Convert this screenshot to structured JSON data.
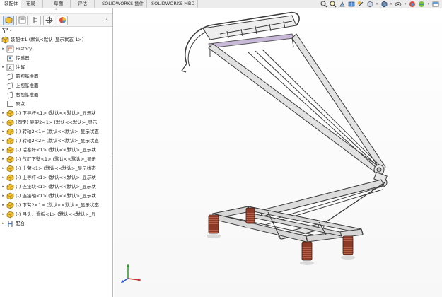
{
  "tabs": [
    "装配体",
    "布局",
    "草图",
    "评估",
    "SOLIDWORKS 插件",
    "SOLIDWORKS MBD"
  ],
  "tree": {
    "root": "装配体1 (默认<默认_显示状态-1>)",
    "items": [
      {
        "label": "History",
        "icon": "history-icon",
        "expandable": true
      },
      {
        "label": "传感器",
        "icon": "sensor-icon",
        "expandable": false
      },
      {
        "label": "注解",
        "icon": "annotation-icon",
        "expandable": true
      },
      {
        "label": "前视基准面",
        "icon": "plane-icon",
        "expandable": false
      },
      {
        "label": "上视基准面",
        "icon": "plane-icon",
        "expandable": false
      },
      {
        "label": "右视基准面",
        "icon": "plane-icon",
        "expandable": false
      },
      {
        "label": "原点",
        "icon": "origin-icon",
        "expandable": false
      },
      {
        "label": "(-) 下导杆<1> (默认<<默认>_显示状",
        "icon": "part-icon",
        "expandable": true
      },
      {
        "label": "(固定) 底架2<1> (默认<<默认>_显示",
        "icon": "part-icon",
        "expandable": true
      },
      {
        "label": "(-) 转轴2<1> (默认<<默认>_显示状态",
        "icon": "part-icon",
        "expandable": true
      },
      {
        "label": "(-) 转轴2<2> (默认<<默认>_显示状态",
        "icon": "part-icon",
        "expandable": true
      },
      {
        "label": "(-) 活塞杆<1> (默认<<默认>_显示状",
        "icon": "part-icon",
        "expandable": true
      },
      {
        "label": "(-) 气缸下壁<1> (默认<<默认>_显示",
        "icon": "part-icon",
        "expandable": true
      },
      {
        "label": "(-) 上臂<1> (默认<<默认>_显示状态",
        "icon": "part-icon",
        "expandable": true
      },
      {
        "label": "(-) 上导杆<1> (默认<<默认>_显示状",
        "icon": "part-icon",
        "expandable": true
      },
      {
        "label": "(-) 连接块<1> (默认<<默认>_显示状",
        "icon": "part-icon",
        "expandable": true
      },
      {
        "label": "(-) 连接轴<1> (默认<<默认>_显示状",
        "icon": "part-icon",
        "expandable": true
      },
      {
        "label": "(-) 下臂2<1> (默认<<默认>_显示状态",
        "icon": "part-icon",
        "expandable": true
      },
      {
        "label": "(-) 弓头，滑板<1> (默认<<默认>_显",
        "icon": "part-icon",
        "expandable": true
      },
      {
        "label": "配合",
        "icon": "mate-icon",
        "expandable": true
      }
    ]
  },
  "colors": {
    "part": "#f2c230",
    "spring": "#8b3a2a",
    "frame": "#d7d7d7",
    "outline": "#3a3a3a"
  }
}
